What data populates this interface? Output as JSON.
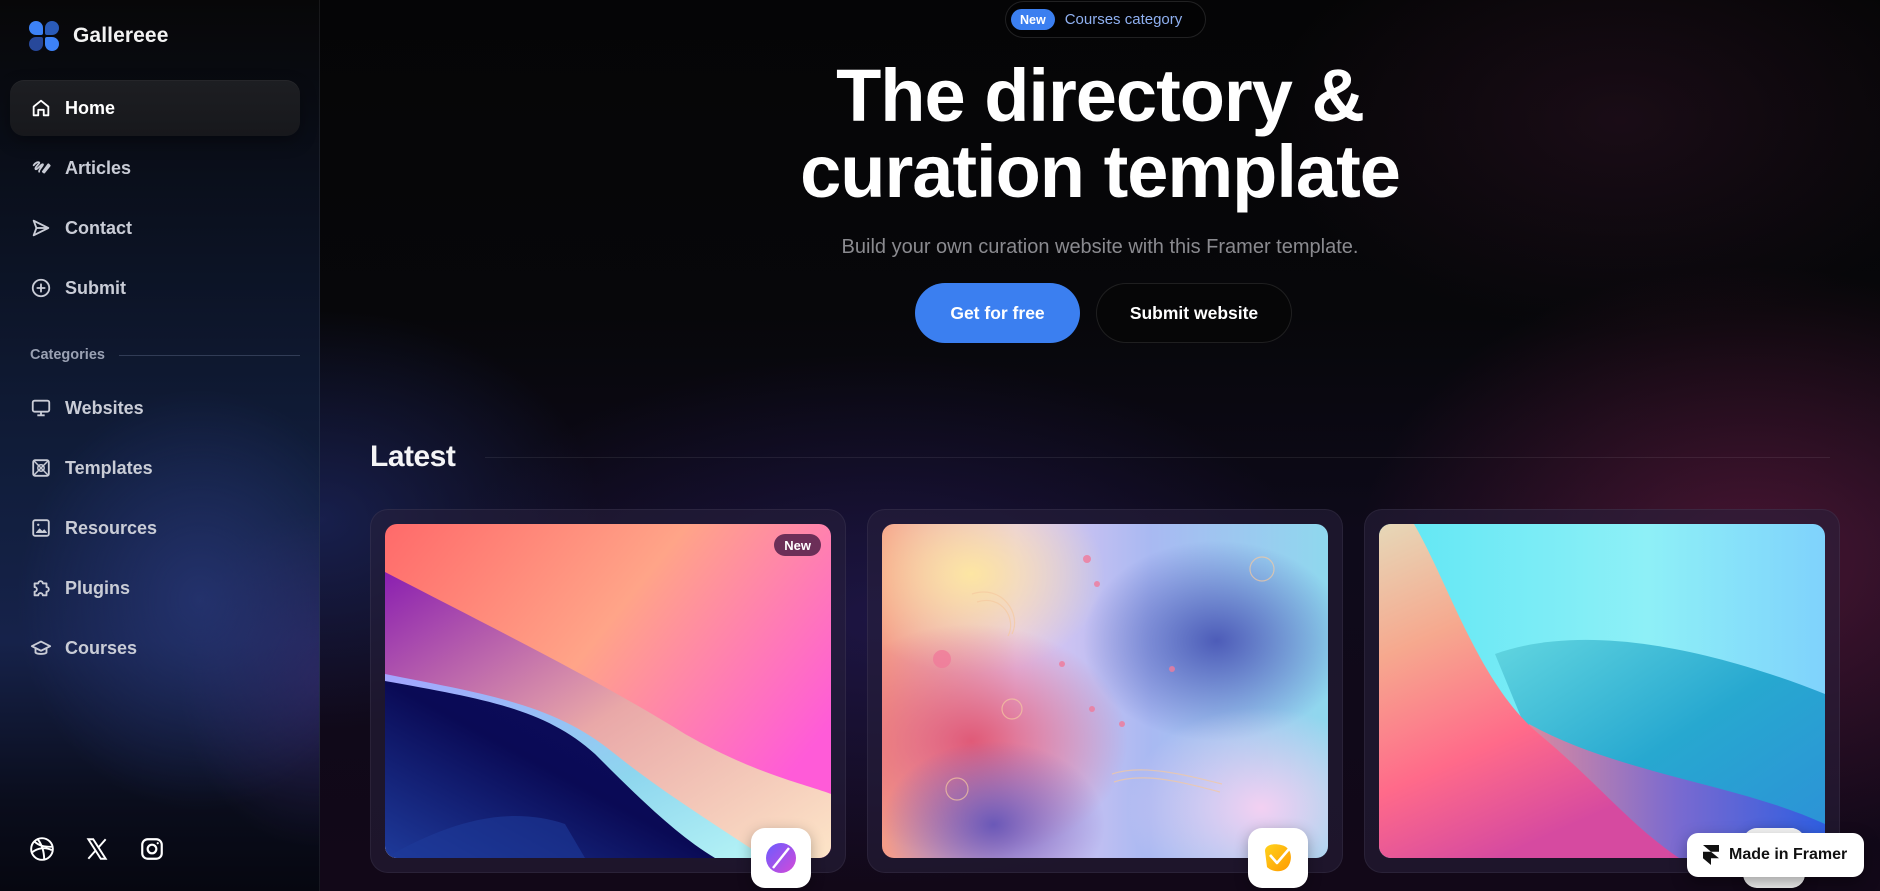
{
  "brand": {
    "name": "Gallereee",
    "accent": "#3b7ff0"
  },
  "sidebar": {
    "primary": [
      {
        "label": "Home",
        "icon": "home-icon",
        "active": true
      },
      {
        "label": "Articles",
        "icon": "pen-icon"
      },
      {
        "label": "Contact",
        "icon": "send-icon"
      },
      {
        "label": "Submit",
        "icon": "plus-circle-icon"
      }
    ],
    "categories_label": "Categories",
    "categories": [
      {
        "label": "Websites",
        "icon": "monitor-icon"
      },
      {
        "label": "Templates",
        "icon": "template-icon"
      },
      {
        "label": "Resources",
        "icon": "image-icon"
      },
      {
        "label": "Plugins",
        "icon": "puzzle-icon"
      },
      {
        "label": "Courses",
        "icon": "graduation-cap-icon"
      }
    ],
    "socials": [
      {
        "name": "Dribbble",
        "icon": "dribbble-icon"
      },
      {
        "name": "X",
        "icon": "x-icon"
      },
      {
        "name": "Instagram",
        "icon": "instagram-icon"
      }
    ]
  },
  "announcement": {
    "badge": "New",
    "text": "Courses category"
  },
  "hero": {
    "title_line1": "The directory &",
    "title_line2": "curation template",
    "subtitle": "Build your own curation website with this Framer template.",
    "primary_button": "Get for free",
    "secondary_button": "Submit website"
  },
  "latest": {
    "title": "Latest",
    "cards": [
      {
        "badge": "New",
        "image": "gradient-wave-sunset",
        "app_icon": "purple-slash-icon"
      },
      {
        "badge": null,
        "image": "liquid-marble-pastel",
        "app_icon": "yellow-check-icon"
      },
      {
        "badge": null,
        "image": "gradient-wave-cyan",
        "app_icon": "white-app-icon"
      }
    ]
  },
  "framer_badge": {
    "text": "Made in Framer",
    "icon": "framer-icon"
  }
}
